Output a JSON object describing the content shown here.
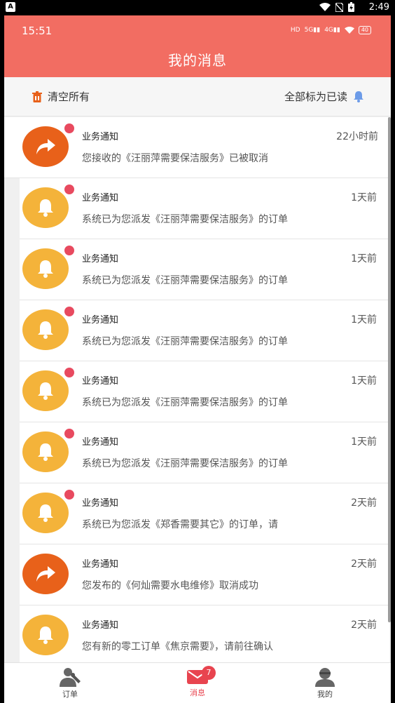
{
  "system": {
    "time": "2:49",
    "app_letter": "A"
  },
  "inner_status": {
    "time": "15:51",
    "battery": "40"
  },
  "header": {
    "title": "我的消息"
  },
  "toolbar": {
    "clear_label": "清空所有",
    "mark_read_label": "全部标为已读"
  },
  "messages": [
    {
      "icon": "share",
      "unread": true,
      "title": "业务通知",
      "time": "22小时前",
      "body": "您接收的《汪丽萍需要保洁服务》已被取消"
    },
    {
      "icon": "bell",
      "unread": true,
      "title": "业务通知",
      "time": "1天前",
      "body": "系统已为您派发《汪丽萍需要保洁服务》的订单"
    },
    {
      "icon": "bell",
      "unread": true,
      "title": "业务通知",
      "time": "1天前",
      "body": "系统已为您派发《汪丽萍需要保洁服务》的订单"
    },
    {
      "icon": "bell",
      "unread": true,
      "title": "业务通知",
      "time": "1天前",
      "body": "系统已为您派发《汪丽萍需要保洁服务》的订单"
    },
    {
      "icon": "bell",
      "unread": true,
      "title": "业务通知",
      "time": "1天前",
      "body": "系统已为您派发《汪丽萍需要保洁服务》的订单"
    },
    {
      "icon": "bell",
      "unread": true,
      "title": "业务通知",
      "time": "1天前",
      "body": "系统已为您派发《汪丽萍需要保洁服务》的订单"
    },
    {
      "icon": "bell",
      "unread": true,
      "title": "业务通知",
      "time": "2天前",
      "body": "系统已为您派发《郑香需要其它》的订单，请"
    },
    {
      "icon": "share",
      "unread": false,
      "title": "业务通知",
      "time": "2天前",
      "body": "您发布的《何灿需要水电维修》取消成功"
    },
    {
      "icon": "bell",
      "unread": false,
      "title": "业务通知",
      "time": "2天前",
      "body": "您有新的零工订单《焦京需要》，请前往确认"
    }
  ],
  "tabs": [
    {
      "label": "订单",
      "icon": "worker-icon",
      "active": false
    },
    {
      "label": "消息",
      "icon": "message-icon",
      "active": true,
      "badge": "7"
    },
    {
      "label": "我的",
      "icon": "profile-icon",
      "active": false
    }
  ],
  "colors": {
    "header": "#f26d62",
    "bell": "#f4b33a",
    "share": "#e8611a",
    "badge": "#e8444f"
  }
}
